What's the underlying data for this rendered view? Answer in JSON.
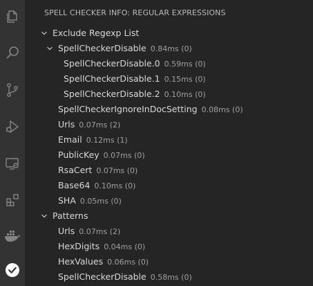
{
  "sidebar": {
    "title": "SPELL CHECKER INFO: REGULAR EXPRESSIONS"
  },
  "activity_bar": {
    "icons": [
      "explorer-icon",
      "search-icon",
      "source-control-icon",
      "run-debug-icon",
      "remote-explorer-icon",
      "extensions-icon",
      "docker-icon",
      "spell-checker-icon"
    ]
  },
  "tree": {
    "exclude": {
      "label": "Exclude Regexp List",
      "disable": {
        "label": "SpellCheckerDisable",
        "desc": "0.84ms (0)",
        "children": [
          {
            "label": "SpellCheckerDisable.0",
            "desc": "0.59ms (0)"
          },
          {
            "label": "SpellCheckerDisable.1",
            "desc": "0.15ms (0)"
          },
          {
            "label": "SpellCheckerDisable.2",
            "desc": "0.10ms (0)"
          }
        ]
      },
      "items": [
        {
          "label": "SpellCheckerIgnoreInDocSetting",
          "desc": "0.08ms (0)"
        },
        {
          "label": "Urls",
          "desc": "0.07ms (2)"
        },
        {
          "label": "Email",
          "desc": "0.12ms (1)"
        },
        {
          "label": "PublicKey",
          "desc": "0.07ms (0)"
        },
        {
          "label": "RsaCert",
          "desc": "0.07ms (0)"
        },
        {
          "label": "Base64",
          "desc": "0.10ms (0)"
        },
        {
          "label": "SHA",
          "desc": "0.05ms (0)"
        }
      ]
    },
    "patterns": {
      "label": "Patterns",
      "items": [
        {
          "label": "Urls",
          "desc": "0.07ms (2)"
        },
        {
          "label": "HexDigits",
          "desc": "0.04ms (0)"
        },
        {
          "label": "HexValues",
          "desc": "0.06ms (0)"
        },
        {
          "label": "SpellCheckerDisable",
          "desc": "0.58ms (0)"
        }
      ]
    }
  },
  "colors": {
    "activity_bar_bg": "#333333",
    "sidebar_bg": "#252526",
    "icon_inactive": "#858585",
    "icon_active": "#ffffff"
  }
}
